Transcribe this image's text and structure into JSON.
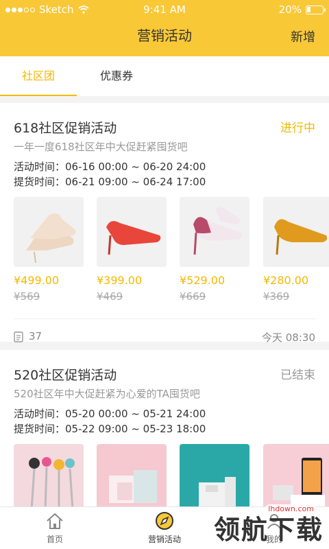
{
  "status_bar": {
    "carrier": "Sketch",
    "time": "9:41 AM",
    "battery": "20%"
  },
  "header": {
    "title": "营销活动",
    "action": "新增"
  },
  "tabs": [
    {
      "label": "社区团",
      "active": true
    },
    {
      "label": "优惠券",
      "active": false
    }
  ],
  "activities": [
    {
      "title": "618社区促销活动",
      "status": "进行中",
      "status_color": "#f5b800",
      "desc": "一年一度618社区年中大促赶紧囤货吧",
      "activity_time": "活动时间：06-16 00:00 ~ 06-20 24:00",
      "pickup_time": "提货时间：06-21 09:00 ~ 06-24 17:00",
      "products": [
        {
          "price": "¥499.00",
          "original": "¥569"
        },
        {
          "price": "¥399.00",
          "original": "¥469"
        },
        {
          "price": "¥529.00",
          "original": "¥669"
        },
        {
          "price": "¥280.00",
          "original": "¥369"
        }
      ],
      "count": "37",
      "time": "今天 08:30"
    },
    {
      "title": "520社区促销活动",
      "status": "已结束",
      "status_color": "#999999",
      "desc": "520社区年中大促赶紧为心爱的TA囤货吧",
      "activity_time": "活动时间：05-20 00:00 ~ 05-21 24:00",
      "pickup_time": "提货时间：05-22 09:00 ~ 05-23 18:00"
    }
  ],
  "tabbar": [
    {
      "label": "首页",
      "icon": "home-icon",
      "active": false
    },
    {
      "label": "营销活动",
      "icon": "compass-icon",
      "active": true
    },
    {
      "label": "",
      "icon": "store-icon",
      "active": false
    },
    {
      "label": "我的",
      "icon": "user-icon",
      "active": false
    }
  ],
  "watermark": {
    "text": "领航下载",
    "url": "lhdown.com"
  }
}
